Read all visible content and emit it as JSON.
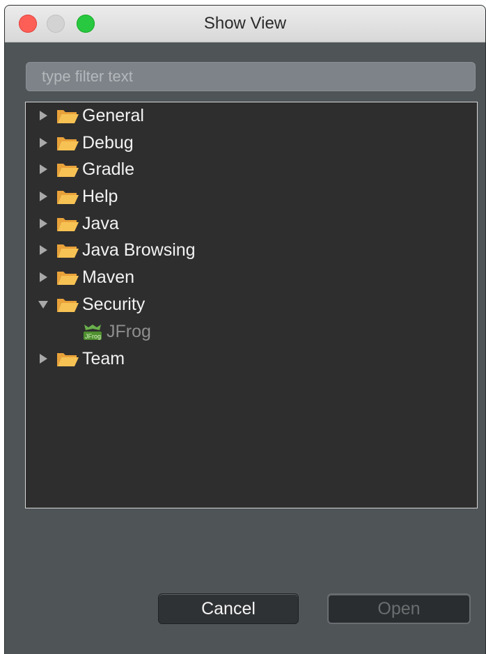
{
  "window": {
    "title": "Show View"
  },
  "filter": {
    "placeholder": "type filter text",
    "value": ""
  },
  "tree": {
    "items": [
      {
        "label": "General",
        "expanded": false
      },
      {
        "label": "Debug",
        "expanded": false
      },
      {
        "label": "Gradle",
        "expanded": false
      },
      {
        "label": "Help",
        "expanded": false
      },
      {
        "label": "Java",
        "expanded": false
      },
      {
        "label": "Java Browsing",
        "expanded": false
      },
      {
        "label": "Maven",
        "expanded": false
      },
      {
        "label": "Security",
        "expanded": true
      },
      {
        "label": "JFrog",
        "child": true
      },
      {
        "label": "Team",
        "expanded": false
      }
    ]
  },
  "buttons": {
    "cancel": "Cancel",
    "open": "Open"
  },
  "icons": {
    "folder": "folder-open-icon",
    "jfrog": "jfrog-icon"
  },
  "colors": {
    "close": "#fd5f57",
    "maximize": "#28c840",
    "folder": "#f5b942"
  }
}
